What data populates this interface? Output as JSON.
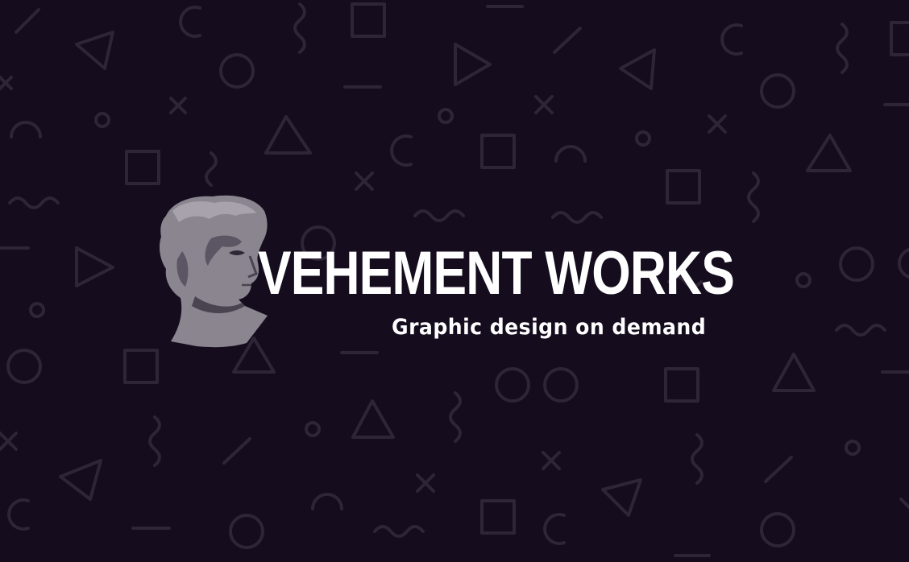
{
  "brand": {
    "title": "VEHEMENT WORKS",
    "tagline": "Graphic design on demand",
    "logo_icon": "classical-statue-head-icon"
  },
  "background": {
    "pattern": "memphis-geometric-shapes"
  },
  "colors": {
    "background": "#150c1e",
    "pattern": "#2e2537",
    "statue": "#8b8590",
    "text": "#ffffff"
  }
}
